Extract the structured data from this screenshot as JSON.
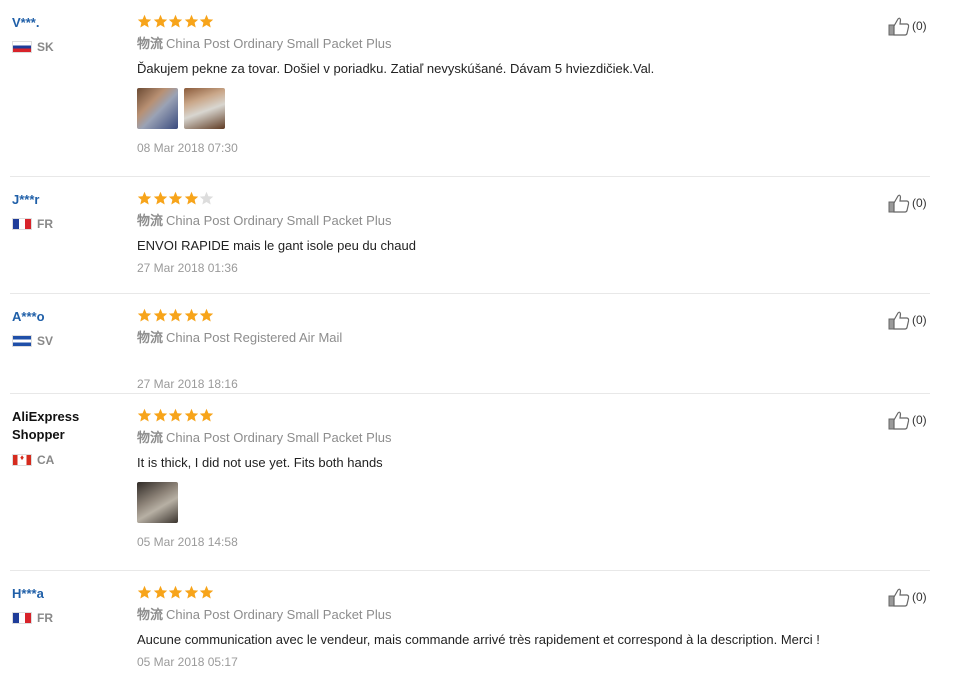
{
  "shipping_label": "物流",
  "colors": {
    "star_filled": "#f7a41a",
    "star_empty": "#dddddd",
    "user_link": "#1f5fa8"
  },
  "reviews": [
    {
      "user": "V***.",
      "country": "SK",
      "flag": "flag-sk",
      "rating": 5,
      "shipping": "China Post Ordinary Small Packet Plus",
      "comment": "Ďakujem pekne za tovar. Došiel v poriadku. Zatiaľ nevyskúšané. Dávam 5 hviezdičiek.Val.",
      "photos": 2,
      "date": "08 Mar 2018 07:30",
      "likes": "(0)"
    },
    {
      "user": "J***r",
      "country": "FR",
      "flag": "flag-fr",
      "rating": 4,
      "shipping": "China Post Ordinary Small Packet Plus",
      "comment": "ENVOI RAPIDE mais le gant isole peu du chaud",
      "photos": 0,
      "date": "27 Mar 2018 01:36",
      "likes": "(0)"
    },
    {
      "user": "A***o",
      "country": "SV",
      "flag": "flag-sv",
      "rating": 5,
      "shipping": "China Post Registered Air Mail",
      "comment": "",
      "photos": 0,
      "date": "27 Mar 2018 18:16",
      "likes": "(0)"
    },
    {
      "user": "AliExpress Shopper",
      "country": "CA",
      "flag": "flag-ca",
      "rating": 5,
      "shipping": "China Post Ordinary Small Packet Plus",
      "comment": "It is thick, I did not use yet. Fits both hands",
      "photos": 1,
      "date": "05 Mar 2018 14:58",
      "likes": "(0)"
    },
    {
      "user": "H***a",
      "country": "FR",
      "flag": "flag-fr",
      "rating": 5,
      "shipping": "China Post Ordinary Small Packet Plus",
      "comment": "Aucune communication avec le vendeur, mais commande arrivé très rapidement et correspond à la description. Merci !",
      "photos": 0,
      "date": "05 Mar 2018 05:17",
      "likes": "(0)"
    }
  ]
}
